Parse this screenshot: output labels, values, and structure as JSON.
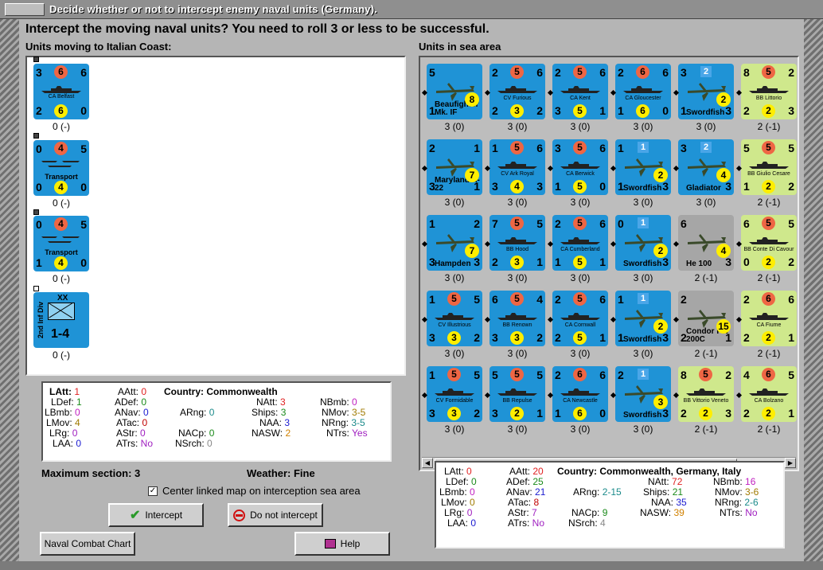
{
  "window": {
    "title": "Decide whether or not to intercept enemy naval units (Germany)."
  },
  "heading": "Intercept the moving naval units?  You need to roll 3 or less to be successful.",
  "left_label": "Units moving to Italian Coast:",
  "right_label": "Units in sea area",
  "moving_units": [
    {
      "name": "CA Belfast",
      "tl": "3",
      "tr": "6",
      "att": "6",
      "def": "6",
      "bl": "2",
      "br": "0",
      "sub": "0 (-)"
    },
    {
      "name": "Transport",
      "tl": "0",
      "tr": "5",
      "att": "4",
      "def": "4",
      "bl": "0",
      "br": "0",
      "sub": "0 (-)"
    },
    {
      "name": "Transport",
      "tl": "0",
      "tr": "5",
      "att": "4",
      "def": "4",
      "bl": "1",
      "br": "0",
      "sub": "0 (-)"
    },
    {
      "name": "2nd Inf Div",
      "corps": "XX",
      "strength": "1-4",
      "sub": "0 (-)"
    }
  ],
  "sea_units": [
    [
      {
        "name": "Beaufighter Mk. IF",
        "sub": "3 (0)",
        "tl": "5",
        "att": "",
        "def": "8",
        "bl": "1",
        "br": "",
        "type": "plane"
      },
      {
        "name": "CV Furious",
        "sub": "3 (0)",
        "tl": "2",
        "tr": "6",
        "att": "5",
        "def": "3",
        "bl": "2",
        "br": "2",
        "type": "ship"
      },
      {
        "name": "CA Kent",
        "sub": "3 (0)",
        "tl": "2",
        "tr": "6",
        "att": "5",
        "def": "5",
        "bl": "3",
        "br": "1",
        "type": "ship"
      },
      {
        "name": "CA Gloucester",
        "sub": "3 (0)",
        "tl": "2",
        "tr": "6",
        "att": "6",
        "def": "6",
        "bl": "1",
        "br": "0",
        "type": "ship"
      },
      {
        "name": "Swordfish",
        "sub": "3 (0)",
        "tl": "3",
        "att": "2",
        "def": "2",
        "bl": "1",
        "br": "3",
        "type": "plane"
      },
      {
        "name": "BB Littorio",
        "sub": "2 (-1)",
        "tl": "8",
        "tr": "2",
        "att": "5",
        "def": "2",
        "bl": "2",
        "br": "3",
        "type": "green"
      }
    ],
    [
      {
        "name": "Maryland A-22",
        "sub": "3 (0)",
        "tl": "2",
        "tr": "1",
        "att": "",
        "def": "7",
        "bl": "3",
        "br": "1",
        "type": "plane"
      },
      {
        "name": "CV Ark Royal",
        "sub": "3 (0)",
        "tl": "1",
        "tr": "6",
        "att": "5",
        "def": "4",
        "bl": "3",
        "br": "3",
        "type": "ship"
      },
      {
        "name": "CA Berwick",
        "sub": "3 (0)",
        "tl": "3",
        "tr": "6",
        "att": "5",
        "def": "5",
        "bl": "1",
        "br": "0",
        "type": "ship"
      },
      {
        "name": "Swordfish",
        "sub": "3 (0)",
        "tl": "1",
        "att": "1",
        "def": "2",
        "bl": "1",
        "br": "3",
        "type": "plane"
      },
      {
        "name": "Gladiator",
        "sub": "3 (0)",
        "tl": "3",
        "att": "2",
        "def": "4",
        "bl": "",
        "br": "3",
        "type": "plane"
      },
      {
        "name": "BB Giulio Cesare",
        "sub": "2 (-1)",
        "tl": "5",
        "tr": "5",
        "att": "5",
        "def": "2",
        "bl": "1",
        "br": "2",
        "type": "green"
      }
    ],
    [
      {
        "name": "Hampden",
        "sub": "3 (0)",
        "tl": "1",
        "tr": "2",
        "att": "",
        "def": "7",
        "bl": "3",
        "br": "3",
        "type": "plane"
      },
      {
        "name": "BB Hood",
        "sub": "3 (0)",
        "tl": "7",
        "tr": "5",
        "att": "5",
        "def": "3",
        "bl": "2",
        "br": "1",
        "type": "ship"
      },
      {
        "name": "CA Cumberland",
        "sub": "3 (0)",
        "tl": "2",
        "tr": "6",
        "att": "5",
        "def": "5",
        "bl": "1",
        "br": "1",
        "type": "ship"
      },
      {
        "name": "Swordfish",
        "sub": "3 (0)",
        "tl": "0",
        "att": "1",
        "def": "2",
        "bl": "",
        "br": "3",
        "type": "plane"
      },
      {
        "name": "He 100",
        "sub": "2 (-1)",
        "tl": "6",
        "att": "",
        "def": "4",
        "bl": "",
        "br": "3",
        "type": "grey"
      },
      {
        "name": "BB Conte Di Cavour",
        "sub": "2 (-1)",
        "tl": "6",
        "tr": "5",
        "att": "5",
        "def": "2",
        "bl": "0",
        "br": "2",
        "type": "green"
      }
    ],
    [
      {
        "name": "CV Illustrious",
        "sub": "3 (0)",
        "tl": "1",
        "tr": "5",
        "att": "5",
        "def": "3",
        "bl": "3",
        "br": "2",
        "type": "ship"
      },
      {
        "name": "BB Renown",
        "sub": "3 (0)",
        "tl": "6",
        "tr": "4",
        "att": "5",
        "def": "3",
        "bl": "3",
        "br": "2",
        "type": "ship"
      },
      {
        "name": "CA Cornwall",
        "sub": "3 (0)",
        "tl": "2",
        "tr": "6",
        "att": "5",
        "def": "5",
        "bl": "2",
        "br": "1",
        "type": "ship"
      },
      {
        "name": "Swordfish",
        "sub": "3 (0)",
        "tl": "1",
        "att": "1",
        "def": "2",
        "bl": "1",
        "br": "3",
        "type": "plane"
      },
      {
        "name": "Condor FW 200C",
        "sub": "2 (-1)",
        "tl": "2",
        "att": "",
        "def": "15",
        "bl": "2",
        "br": "1",
        "type": "grey"
      },
      {
        "name": "CA Fiume",
        "sub": "2 (-1)",
        "tl": "2",
        "tr": "6",
        "att": "6",
        "def": "2",
        "bl": "2",
        "br": "1",
        "type": "green"
      }
    ],
    [
      {
        "name": "CV Formidable",
        "sub": "3 (0)",
        "tl": "1",
        "tr": "5",
        "att": "5",
        "def": "3",
        "bl": "3",
        "br": "2",
        "type": "ship"
      },
      {
        "name": "BB Repulse",
        "sub": "3 (0)",
        "tl": "5",
        "tr": "5",
        "att": "5",
        "def": "2",
        "bl": "3",
        "br": "1",
        "type": "ship"
      },
      {
        "name": "CA Newcastle",
        "sub": "3 (0)",
        "tl": "2",
        "tr": "6",
        "att": "6",
        "def": "6",
        "bl": "1",
        "br": "0",
        "type": "ship"
      },
      {
        "name": "Swordfish",
        "sub": "3 (0)",
        "tl": "2",
        "att": "1",
        "def": "3",
        "bl": "",
        "br": "3",
        "type": "plane"
      },
      {
        "name": "BB Vittorio Veneto",
        "sub": "2 (-1)",
        "tl": "8",
        "tr": "2",
        "att": "5",
        "def": "2",
        "bl": "2",
        "br": "3",
        "type": "green"
      },
      {
        "name": "CA Bolzano",
        "sub": "2 (-1)",
        "tl": "4",
        "tr": "5",
        "att": "6",
        "def": "2",
        "bl": "2",
        "br": "1",
        "type": "green"
      }
    ]
  ],
  "left_stats": {
    "latt": "LAtt:",
    "latt_v": "1",
    "ldef": "LDef:",
    "ldef_v": "1",
    "lbmb": "LBmb:",
    "lbmb_v": "0",
    "lmov": "LMov:",
    "lmov_v": "4",
    "lrg": "LRg:",
    "lrg_v": "0",
    "laa": "LAA:",
    "laa_v": "0",
    "aatt": "AAtt:",
    "aatt_v": "0",
    "adef": "ADef:",
    "adef_v": "0",
    "anav": "ANav:",
    "anav_v": "0",
    "atac": "ATac:",
    "atac_v": "0",
    "astr": "AStr:",
    "astr_v": "0",
    "atrs": "ATrs:",
    "atrs_v": "No",
    "country": "Country: Commonwealth",
    "arng": "ARng:",
    "arng_v": "0",
    "nacp": "NACp:",
    "nacp_v": "0",
    "nsrch": "NSrch:",
    "nsrch_v": "0",
    "natt": "NAtt:",
    "natt_v": "3",
    "ships": "Ships:",
    "ships_v": "3",
    "naa": "NAA:",
    "naa_v": "3",
    "nasw": "NASW:",
    "nasw_v": "2",
    "nbmb": "NBmb:",
    "nbmb_v": "0",
    "nmov": "NMov:",
    "nmov_v": "3-5",
    "nrng": "NRng:",
    "nrng_v": "3-5",
    "ntrs": "NTrs:",
    "ntrs_v": "Yes"
  },
  "right_stats": {
    "latt": "LAtt:",
    "latt_v": "0",
    "ldef": "LDef:",
    "ldef_v": "0",
    "lbmb": "LBmb:",
    "lbmb_v": "0",
    "lmov": "LMov:",
    "lmov_v": "0",
    "lrg": "LRg:",
    "lrg_v": "0",
    "laa": "LAA:",
    "laa_v": "0",
    "aatt": "AAtt:",
    "aatt_v": "20",
    "adef": "ADef:",
    "adef_v": "25",
    "anav": "ANav:",
    "anav_v": "21",
    "atac": "ATac:",
    "atac_v": "8",
    "astr": "AStr:",
    "astr_v": "7",
    "atrs": "ATrs:",
    "atrs_v": "No",
    "country": "Country: Commonwealth, Germany, Italy",
    "arng": "ARng:",
    "arng_v": "2-15",
    "nacp": "NACp:",
    "nacp_v": "9",
    "nsrch": "NSrch:",
    "nsrch_v": "4",
    "natt": "NAtt:",
    "natt_v": "72",
    "ships": "Ships:",
    "ships_v": "21",
    "naa": "NAA:",
    "naa_v": "35",
    "nasw": "NASW:",
    "nasw_v": "39",
    "nbmb": "NBmb:",
    "nbmb_v": "16",
    "nmov": "NMov:",
    "nmov_v": "3-6",
    "nrng": "NRng:",
    "nrng_v": "2-6",
    "ntrs": "NTrs:",
    "ntrs_v": "No"
  },
  "max_section": "Maximum section: 3",
  "weather": "Weather:  Fine",
  "center_checkbox": "Center linked map on interception sea area",
  "buttons": {
    "intercept": "Intercept",
    "no_intercept": "Do not intercept",
    "chart": "Naval Combat Chart",
    "help": "Help"
  },
  "colors": {
    "allied": "#1f93d6",
    "italian": "#cfe88c",
    "german": "#a6a6a6",
    "red": "#e02020",
    "green": "#1a8a1a",
    "blue": "#1a1ad0",
    "orange": "#d08000",
    "teal": "#1a8a8a",
    "purple": "#a020c0",
    "magenta": "#c020c0"
  }
}
